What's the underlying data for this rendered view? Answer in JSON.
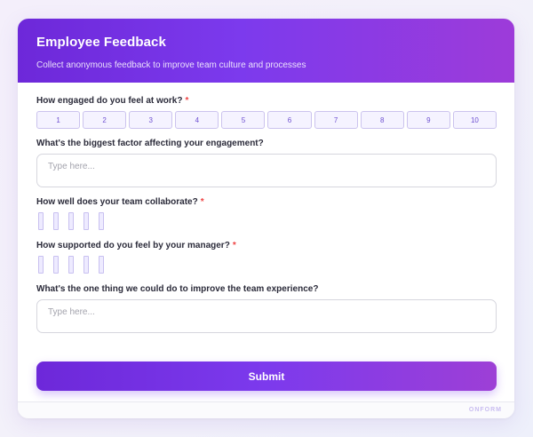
{
  "form": {
    "title": "Employee Feedback",
    "subtitle": "Collect anonymous feedback to improve team culture and processes"
  },
  "questions": {
    "engagement": {
      "label": "How engaged do you feel at work?",
      "required_mark": "*",
      "scale": [
        "1",
        "2",
        "3",
        "4",
        "5",
        "6",
        "7",
        "8",
        "9",
        "10"
      ]
    },
    "factor": {
      "label": "What's the biggest factor affecting your engagement?",
      "placeholder": "Type here..."
    },
    "collaborate": {
      "label": "How well does your team collaborate?",
      "required_mark": "*"
    },
    "supported": {
      "label": "How supported do you feel by your manager?",
      "required_mark": "*"
    },
    "improve": {
      "label": "What's the one thing we could do to improve the team experience?",
      "placeholder": "Type here..."
    }
  },
  "submit_label": "Submit",
  "brand": "ONFORM",
  "colors": {
    "accent": "#7c3aed",
    "accent_end": "#9d3bd9",
    "required": "#ef4444"
  }
}
